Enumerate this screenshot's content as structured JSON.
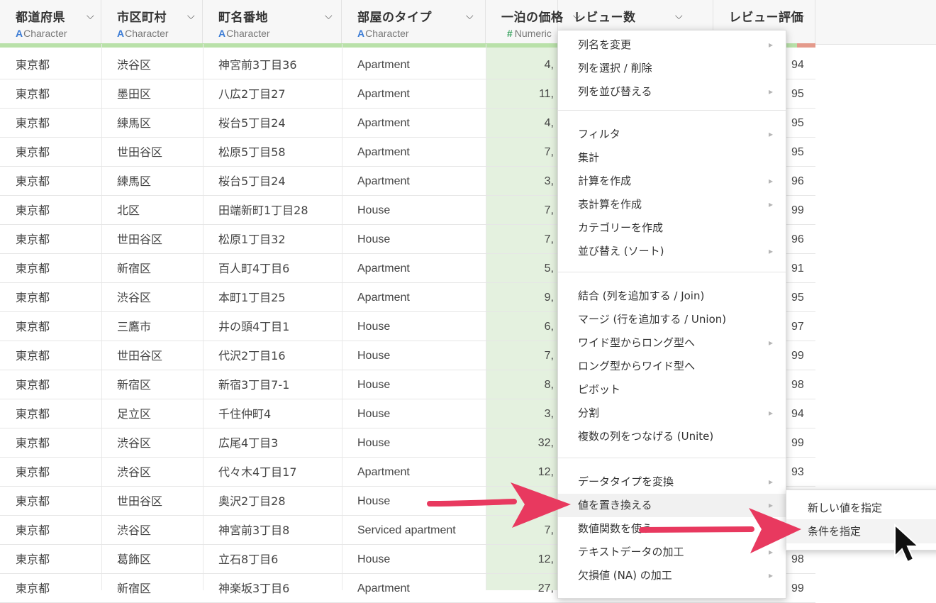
{
  "columns": [
    {
      "name": "都道府県",
      "type": "Character",
      "type_icon": "A"
    },
    {
      "name": "市区町村",
      "type": "Character",
      "type_icon": "A"
    },
    {
      "name": "町名番地",
      "type": "Character",
      "type_icon": "A"
    },
    {
      "name": "部屋のタイプ",
      "type": "Character",
      "type_icon": "A"
    },
    {
      "name": "一泊の価格",
      "type": "Numeric",
      "type_icon": "#"
    },
    {
      "name": "レビュー数",
      "type": "",
      "type_icon": ""
    },
    {
      "name": "レビュー評価",
      "type": "",
      "type_icon": ""
    }
  ],
  "rows": [
    [
      "東京都",
      "渋谷区",
      "神宮前3丁目36",
      "Apartment",
      "4,",
      "94"
    ],
    [
      "東京都",
      "墨田区",
      "八広2丁目27",
      "Apartment",
      "11,",
      "95"
    ],
    [
      "東京都",
      "練馬区",
      "桜台5丁目24",
      "Apartment",
      "4,",
      "95"
    ],
    [
      "東京都",
      "世田谷区",
      "松原5丁目58",
      "Apartment",
      "7,",
      "95"
    ],
    [
      "東京都",
      "練馬区",
      "桜台5丁目24",
      "Apartment",
      "3,",
      "96"
    ],
    [
      "東京都",
      "北区",
      "田端新町1丁目28",
      "House",
      "7,",
      "99"
    ],
    [
      "東京都",
      "世田谷区",
      "松原1丁目32",
      "House",
      "7,",
      "96"
    ],
    [
      "東京都",
      "新宿区",
      "百人町4丁目6",
      "Apartment",
      "5,",
      "91"
    ],
    [
      "東京都",
      "渋谷区",
      "本町1丁目25",
      "Apartment",
      "9,",
      "95"
    ],
    [
      "東京都",
      "三鷹市",
      "井の頭4丁目1",
      "House",
      "6,",
      "97"
    ],
    [
      "東京都",
      "世田谷区",
      "代沢2丁目16",
      "House",
      "7,",
      "99"
    ],
    [
      "東京都",
      "新宿区",
      "新宿3丁目7-1",
      "House",
      "8,",
      "98"
    ],
    [
      "東京都",
      "足立区",
      "千住仲町4",
      "House",
      "3,",
      "94"
    ],
    [
      "東京都",
      "渋谷区",
      "広尾4丁目3",
      "House",
      "32,",
      "99"
    ],
    [
      "東京都",
      "渋谷区",
      "代々木4丁目17",
      "Apartment",
      "12,",
      "93"
    ],
    [
      "東京都",
      "世田谷区",
      "奥沢2丁目28",
      "House",
      "",
      ""
    ],
    [
      "東京都",
      "渋谷区",
      "神宮前3丁目8",
      "Serviced apartment",
      "7,",
      ""
    ],
    [
      "東京都",
      "葛飾区",
      "立石8丁目6",
      "House",
      "12,",
      "98"
    ],
    [
      "東京都",
      "新宿区",
      "神楽坂3丁目6",
      "Apartment",
      "27,",
      "99"
    ]
  ],
  "menu": {
    "groups": [
      [
        {
          "label": "列名を変更",
          "submenu": true
        },
        {
          "label": "列を選択 / 削除",
          "submenu": false
        },
        {
          "label": "列を並び替える",
          "submenu": true
        }
      ],
      [
        {
          "label": "フィルタ",
          "submenu": true
        },
        {
          "label": "集計",
          "submenu": false
        },
        {
          "label": "計算を作成",
          "submenu": true
        },
        {
          "label": "表計算を作成",
          "submenu": true
        },
        {
          "label": "カテゴリーを作成",
          "submenu": false
        },
        {
          "label": "並び替え (ソート)",
          "submenu": true
        }
      ],
      [
        {
          "label": "結合 (列を追加する / Join)",
          "submenu": false
        },
        {
          "label": "マージ (行を追加する / Union)",
          "submenu": false
        },
        {
          "label": "ワイド型からロング型へ",
          "submenu": true
        },
        {
          "label": "ロング型からワイド型へ",
          "submenu": false
        },
        {
          "label": "ピボット",
          "submenu": false
        },
        {
          "label": "分割",
          "submenu": true
        },
        {
          "label": "複数の列をつなげる (Unite)",
          "submenu": false
        }
      ],
      [
        {
          "label": "データタイプを変換",
          "submenu": true
        },
        {
          "label": "値を置き換える",
          "submenu": true
        },
        {
          "label": "数値関数を使う",
          "submenu": true
        },
        {
          "label": "テキストデータの加工",
          "submenu": true
        },
        {
          "label": "欠損値 (NA) の加工",
          "submenu": true
        }
      ]
    ],
    "hover_item": "値を置き換える"
  },
  "submenu": {
    "items": [
      "新しい値を指定",
      "条件を指定"
    ],
    "hover_item": "条件を指定"
  },
  "colors": {
    "numeric_col_bg": "#e4f1df",
    "quality_bar": "#b9e1a9",
    "quality_bar_missing": "#e49a8b",
    "arrow": "#e8395f",
    "type_character_icon": "#3a7bd5",
    "type_numeric_icon": "#3aa360"
  },
  "icons": {
    "column_dropdown": "chevron-down-icon",
    "submenu_indicator": "chevron-right-icon",
    "cursor": "mouse-pointer-icon"
  }
}
